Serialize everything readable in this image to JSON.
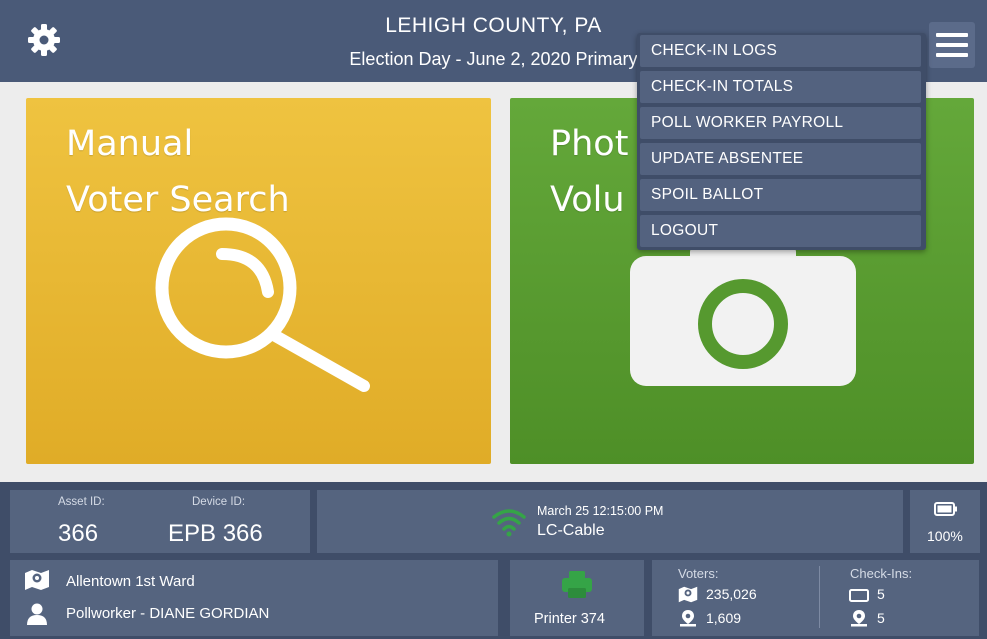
{
  "header": {
    "county": "LEHIGH COUNTY, PA",
    "election": "Election Day - June 2, 2020 Primary"
  },
  "tiles": {
    "manual": {
      "line1": "Manual",
      "line2": "Voter Search"
    },
    "photo": {
      "line1": "Phot",
      "line2": "Volu"
    }
  },
  "menu": {
    "items": [
      "CHECK-IN LOGS",
      "CHECK-IN TOTALS",
      "POLL WORKER PAYROLL",
      "UPDATE ABSENTEE",
      "SPOIL BALLOT",
      "LOGOUT"
    ]
  },
  "status": {
    "asset_label": "Asset ID:",
    "asset_value": "366",
    "device_label": "Device ID:",
    "device_value": "EPB 366",
    "datetime": "March 25  12:15:00 PM",
    "network": "LC-Cable",
    "battery": "100%",
    "battery_level": 1.0
  },
  "info": {
    "ward": "Allentown 1st Ward",
    "pollworker": "Pollworker - DIANE GORDIAN",
    "printer": "Printer 374",
    "voters_label": "Voters:",
    "voters_total": "235,026",
    "voters_precinct": "1,609",
    "checkins_label": "Check-Ins:",
    "checkins_device": "5",
    "checkins_precinct": "5"
  },
  "colors": {
    "header": "#4a5a78",
    "manual_tile": "#e8b832",
    "photo_tile": "#5a9e32",
    "menu_item": "#53627f",
    "accent_green": "#35a447"
  }
}
